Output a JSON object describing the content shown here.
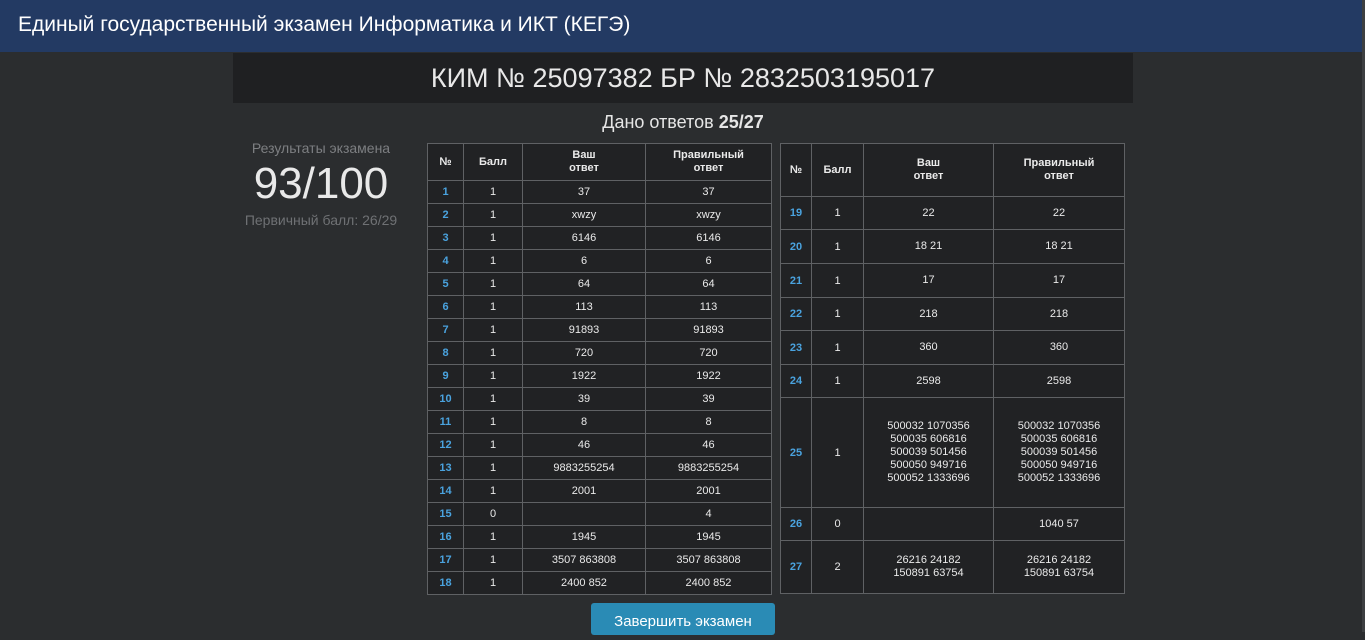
{
  "app": {
    "title": "Единый государственный экзамен Информатика и ИКТ (КЕГЭ)"
  },
  "kim_header": "КИМ № 25097382 БР № 2832503195017",
  "answered": {
    "label": "Дано ответов",
    "value": "25/27"
  },
  "results": {
    "label": "Результаты экзамена",
    "score": "93/100",
    "primary": "Первичный балл: 26/29"
  },
  "table_headers": {
    "num": "№",
    "points": "Балл",
    "yours_line1": "Ваш",
    "yours_line2": "ответ",
    "correct_line1": "Правильный",
    "correct_line2": "ответ"
  },
  "rows_left": [
    {
      "num": "1",
      "points": "1",
      "yours": "37",
      "correct": "37"
    },
    {
      "num": "2",
      "points": "1",
      "yours": "xwzy",
      "correct": "xwzy"
    },
    {
      "num": "3",
      "points": "1",
      "yours": "6146",
      "correct": "6146"
    },
    {
      "num": "4",
      "points": "1",
      "yours": "6",
      "correct": "6"
    },
    {
      "num": "5",
      "points": "1",
      "yours": "64",
      "correct": "64"
    },
    {
      "num": "6",
      "points": "1",
      "yours": "113",
      "correct": "113"
    },
    {
      "num": "7",
      "points": "1",
      "yours": "91893",
      "correct": "91893"
    },
    {
      "num": "8",
      "points": "1",
      "yours": "720",
      "correct": "720"
    },
    {
      "num": "9",
      "points": "1",
      "yours": "1922",
      "correct": "1922"
    },
    {
      "num": "10",
      "points": "1",
      "yours": "39",
      "correct": "39"
    },
    {
      "num": "11",
      "points": "1",
      "yours": "8",
      "correct": "8"
    },
    {
      "num": "12",
      "points": "1",
      "yours": "46",
      "correct": "46"
    },
    {
      "num": "13",
      "points": "1",
      "yours": "9883255254",
      "correct": "9883255254"
    },
    {
      "num": "14",
      "points": "1",
      "yours": "2001",
      "correct": "2001"
    },
    {
      "num": "15",
      "points": "0",
      "yours": "",
      "correct": "4"
    },
    {
      "num": "16",
      "points": "1",
      "yours": "1945",
      "correct": "1945"
    },
    {
      "num": "17",
      "points": "1",
      "yours": "3507 863808",
      "correct": "3507 863808"
    },
    {
      "num": "18",
      "points": "1",
      "yours": "2400 852",
      "correct": "2400 852"
    }
  ],
  "rows_right": [
    {
      "num": "19",
      "points": "1",
      "yours": [
        "22"
      ],
      "correct": [
        "22"
      ]
    },
    {
      "num": "20",
      "points": "1",
      "yours": [
        "18 21"
      ],
      "correct": [
        "18 21"
      ]
    },
    {
      "num": "21",
      "points": "1",
      "yours": [
        "17"
      ],
      "correct": [
        "17"
      ]
    },
    {
      "num": "22",
      "points": "1",
      "yours": [
        "218"
      ],
      "correct": [
        "218"
      ]
    },
    {
      "num": "23",
      "points": "1",
      "yours": [
        "360"
      ],
      "correct": [
        "360"
      ]
    },
    {
      "num": "24",
      "points": "1",
      "yours": [
        "2598"
      ],
      "correct": [
        "2598"
      ]
    },
    {
      "num": "25",
      "points": "1",
      "yours": [
        "500032 1070356",
        "500035 606816",
        "500039 501456",
        "500050 949716",
        "500052 1333696"
      ],
      "correct": [
        "500032 1070356",
        "500035 606816",
        "500039 501456",
        "500050 949716",
        "500052 1333696"
      ]
    },
    {
      "num": "26",
      "points": "0",
      "yours": [],
      "correct": [
        "1040 57"
      ]
    },
    {
      "num": "27",
      "points": "2",
      "yours": [
        "26216 24182",
        "150891 63754"
      ],
      "correct": [
        "26216 24182",
        "150891 63754"
      ]
    }
  ],
  "finish_button": "Завершить экзамен",
  "colors": {
    "topbar": "#233a63",
    "background": "#2b2d2f",
    "header_band": "#1f2022",
    "task_number": "#4aa3df",
    "button": "#2a8bb5"
  }
}
